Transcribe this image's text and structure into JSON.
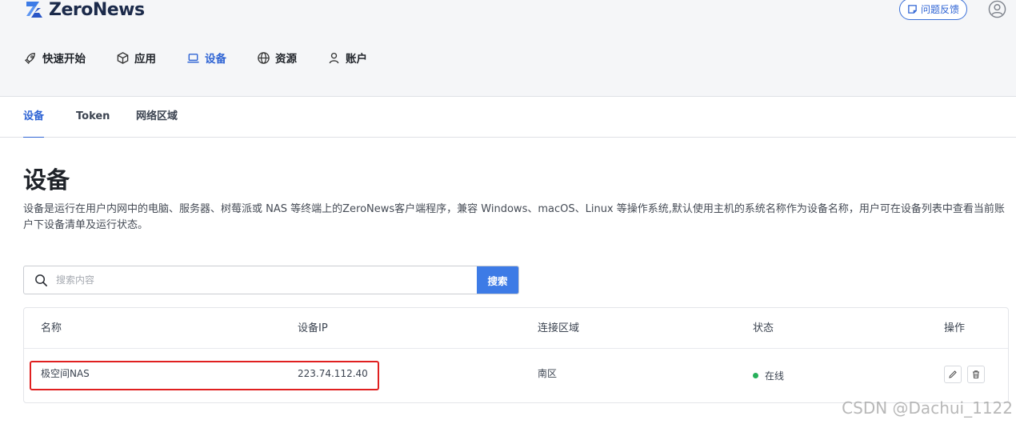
{
  "brand": {
    "name": "ZeroNews"
  },
  "header": {
    "feedback_label": "问题反馈",
    "nav": [
      {
        "label": "快速开始",
        "icon": "rocket-icon"
      },
      {
        "label": "应用",
        "icon": "cube-icon"
      },
      {
        "label": "设备",
        "icon": "laptop-icon",
        "active": true
      },
      {
        "label": "资源",
        "icon": "globe-icon"
      },
      {
        "label": "账户",
        "icon": "user-icon"
      }
    ]
  },
  "subtabs": [
    {
      "label": "设备",
      "active": true
    },
    {
      "label": "Token"
    },
    {
      "label": "网络区域"
    }
  ],
  "page": {
    "title": "设备",
    "description": "设备是运行在用户内网中的电脑、服务器、树莓派或 NAS 等终端上的ZeroNews客户端程序，兼容 Windows、macOS、Linux 等操作系统,默认使用主机的系统名称作为设备名称，用户可在设备列表中查看当前账户下设备清单及运行状态。"
  },
  "search": {
    "placeholder": "搜索内容",
    "button_label": "搜索"
  },
  "table": {
    "columns": [
      "名称",
      "设备IP",
      "连接区域",
      "状态",
      "操作"
    ],
    "rows": [
      {
        "name": "极空间NAS",
        "ip": "223.74.112.40",
        "region": "南区",
        "status": "在线"
      }
    ]
  },
  "colors": {
    "accent": "#2f64d4",
    "search_button": "#3d7be6",
    "online": "#27b05a",
    "highlight": "#e02020"
  },
  "watermark": "CSDN @Dachui_1122"
}
